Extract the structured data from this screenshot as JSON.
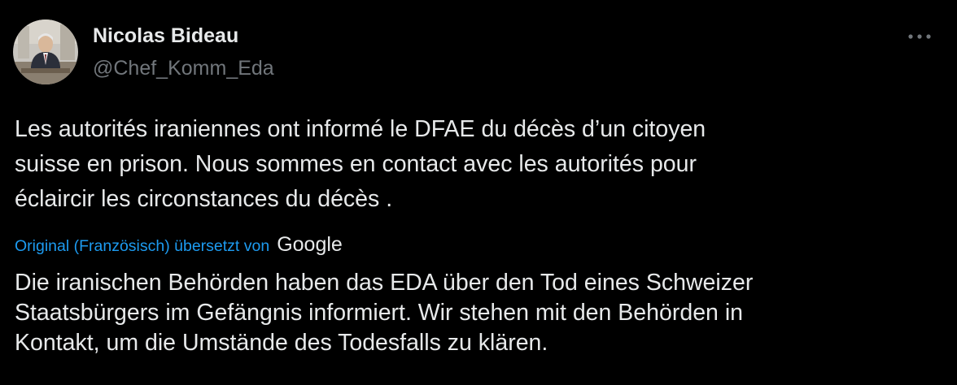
{
  "author": {
    "display_name": "Nicolas Bideau",
    "handle": "@Chef_Komm_Eda"
  },
  "menu": {
    "icon": "more-horizontal-icon"
  },
  "tweet": {
    "text_lines": [
      "Les autorités iraniennes ont informé le DFAE du décès d’un citoyen",
      "suisse en prison. Nous sommes en contact avec les autorités pour",
      "éclaircir les circonstances du décès ."
    ]
  },
  "translation": {
    "attribution": "Original (Französisch) übersetzt von",
    "provider": "Google",
    "text_lines": [
      "Die iranischen Behörden haben das EDA über den Tod eines Schweizer",
      "Staatsbürgers im Gefängnis informiert. Wir stehen mit den Behörden in",
      "Kontakt, um die Umstände des Todesfalls zu klären."
    ]
  },
  "colors": {
    "background": "#000000",
    "primary_text": "#e7e9ea",
    "secondary_text": "#71767b",
    "link": "#1d9bf0"
  }
}
